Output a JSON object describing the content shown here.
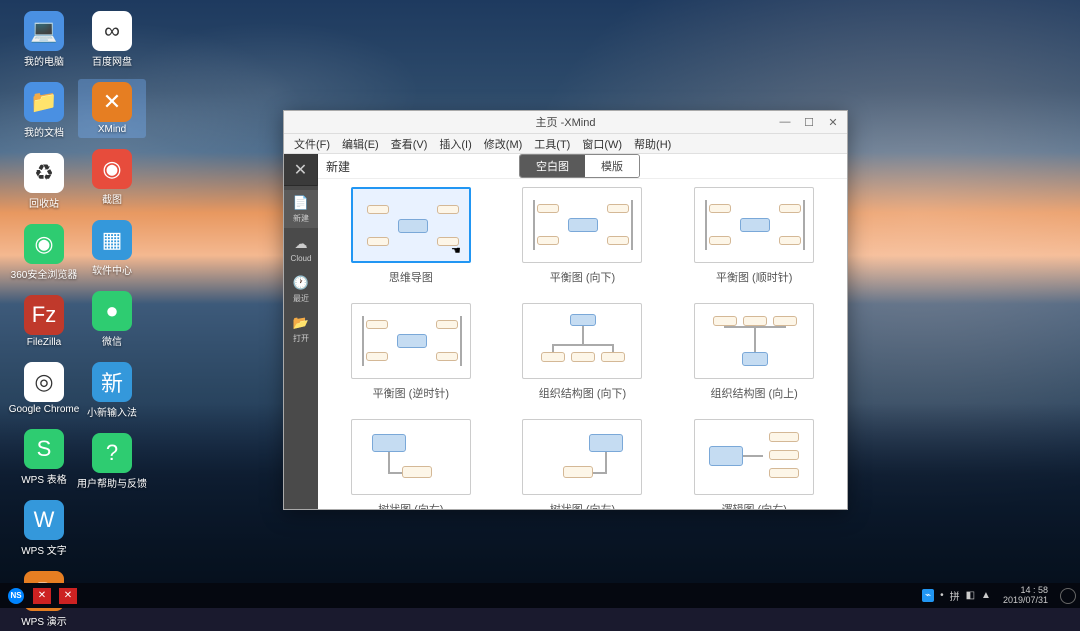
{
  "desktop": {
    "cols": [
      [
        {
          "label": "我的电脑",
          "bg": "#4a90e2",
          "glyph": "💻"
        },
        {
          "label": "我的文档",
          "bg": "#4a90e2",
          "glyph": "📁"
        },
        {
          "label": "回收站",
          "bg": "#ffffff",
          "glyph": "♻"
        },
        {
          "label": "360安全浏览器",
          "bg": "#2ecc71",
          "glyph": "◉"
        },
        {
          "label": "FileZilla",
          "bg": "#c0392b",
          "glyph": "Fz"
        },
        {
          "label": "Google Chrome",
          "bg": "#ffffff",
          "glyph": "◎"
        },
        {
          "label": "WPS 表格",
          "bg": "#2ecc71",
          "glyph": "S"
        },
        {
          "label": "WPS 文字",
          "bg": "#3498db",
          "glyph": "W"
        },
        {
          "label": "WPS 演示",
          "bg": "#e67e22",
          "glyph": "P"
        }
      ],
      [
        {
          "label": "百度网盘",
          "bg": "#ffffff",
          "glyph": "∞"
        },
        {
          "label": "XMind",
          "bg": "#e67e22",
          "glyph": "✕",
          "selected": true
        },
        {
          "label": "截图",
          "bg": "#e74c3c",
          "glyph": "◉"
        },
        {
          "label": "软件中心",
          "bg": "#3498db",
          "glyph": "▦"
        },
        {
          "label": "微信",
          "bg": "#2ecc71",
          "glyph": "●"
        },
        {
          "label": "小新输入法",
          "bg": "#3498db",
          "glyph": "新"
        },
        {
          "label": "用户帮助与反馈",
          "bg": "#2ecc71",
          "glyph": "?"
        }
      ]
    ]
  },
  "window": {
    "title": "主页 -XMind",
    "menu": [
      "文件(F)",
      "编辑(E)",
      "查看(V)",
      "插入(I)",
      "修改(M)",
      "工具(T)",
      "窗口(W)",
      "帮助(H)"
    ],
    "sidebar": [
      {
        "label": "新建",
        "glyph": "📄",
        "active": true
      },
      {
        "label": "Cloud",
        "glyph": "☁"
      },
      {
        "label": "最近",
        "glyph": "🕐"
      },
      {
        "label": "打开",
        "glyph": "📂"
      }
    ],
    "section_label": "新建",
    "tabs": {
      "blank": "空白图",
      "template": "模版"
    },
    "templates": [
      {
        "label": "思维导图",
        "type": "mindmap",
        "selected": true
      },
      {
        "label": "平衡图 (向下)",
        "type": "balance-down"
      },
      {
        "label": "平衡图 (顺时针)",
        "type": "balance-cw"
      },
      {
        "label": "平衡图 (逆时针)",
        "type": "balance-ccw"
      },
      {
        "label": "组织结构图 (向下)",
        "type": "org-down"
      },
      {
        "label": "组织结构图 (向上)",
        "type": "org-up"
      },
      {
        "label": "树状图 (向右)",
        "type": "tree-right"
      },
      {
        "label": "树状图 (向左)",
        "type": "tree-left"
      },
      {
        "label": "逻辑图 (向右)",
        "type": "logic-right"
      }
    ]
  },
  "taskbar": {
    "items": [
      "NS",
      "✕",
      "✕"
    ],
    "ime": "拼",
    "time": "14 : 58",
    "date": "2019/07/31"
  }
}
